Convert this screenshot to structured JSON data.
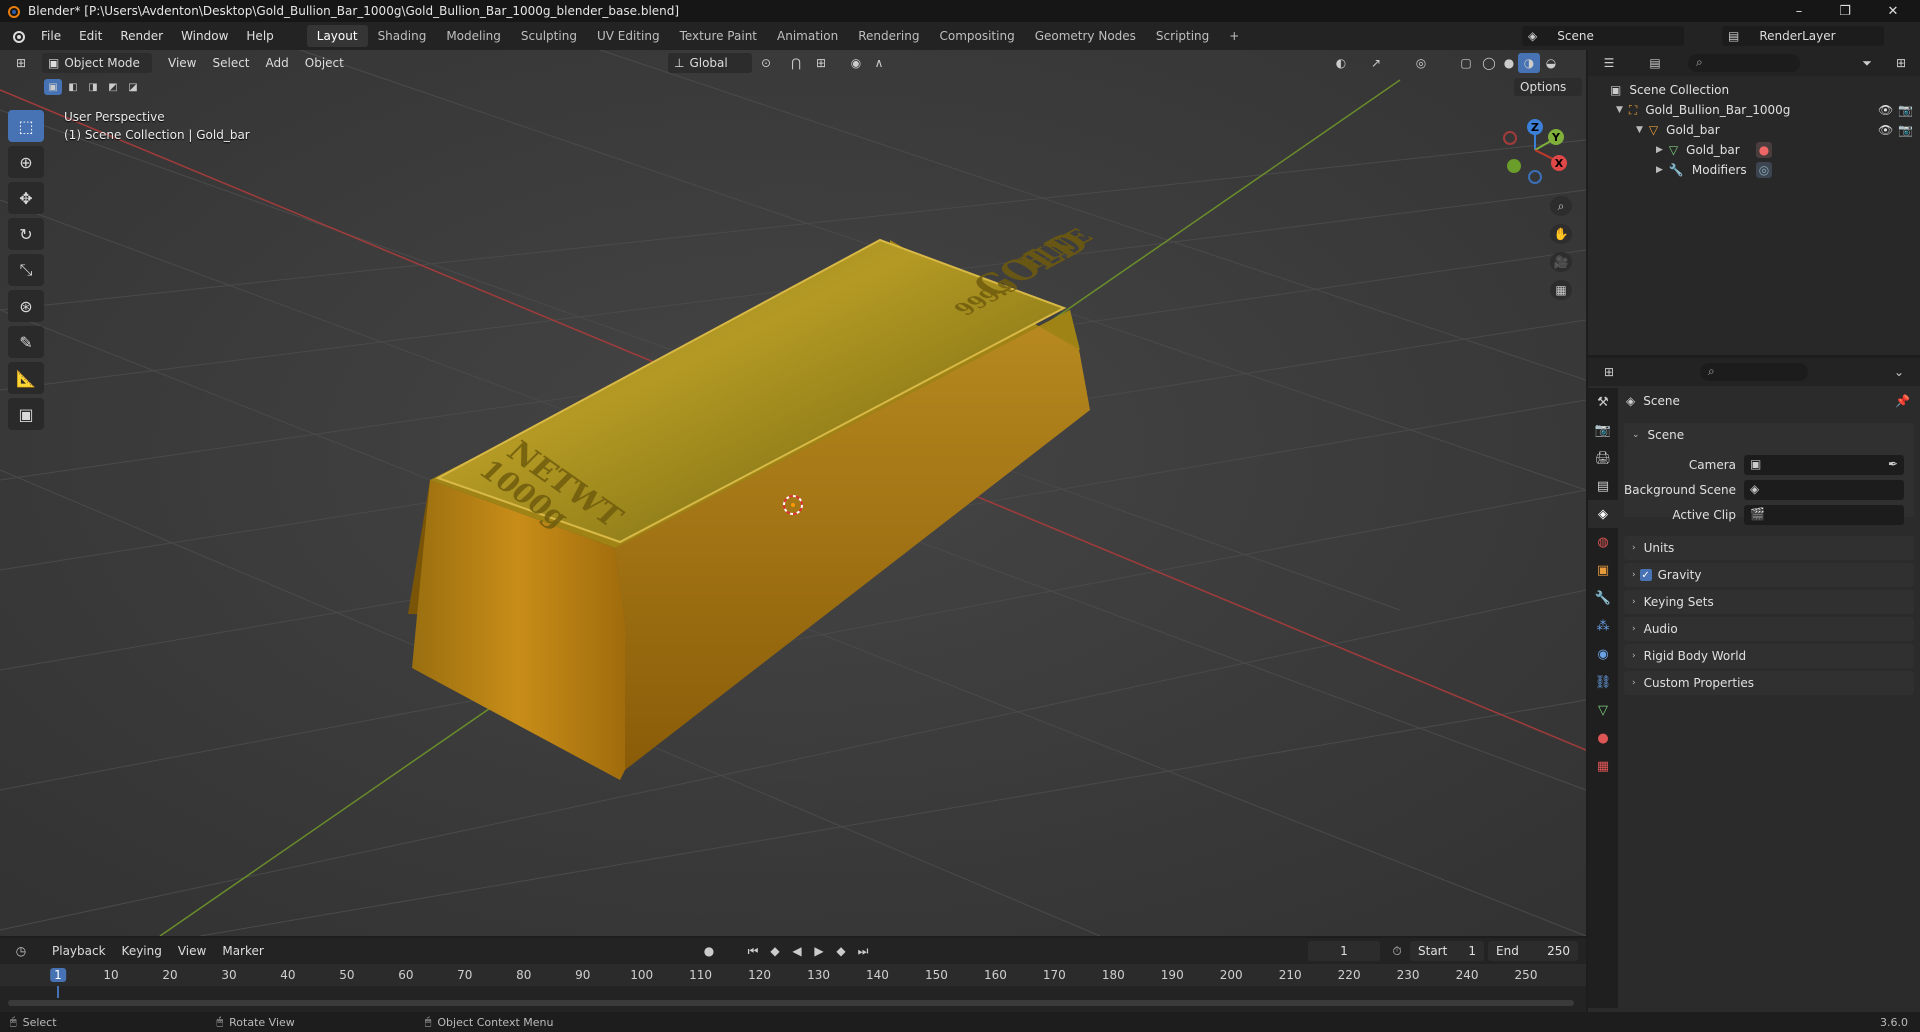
{
  "window": {
    "title": "Blender* [P:\\Users\\Avdenton\\Desktop\\Gold_Bullion_Bar_1000g\\Gold_Bullion_Bar_1000g_blender_base.blend]",
    "minimize": "–",
    "maximize": "❐",
    "close": "✕"
  },
  "menu": [
    "File",
    "Edit",
    "Render",
    "Window",
    "Help"
  ],
  "workspaces": [
    "Layout",
    "Shading",
    "Modeling",
    "Sculpting",
    "UV Editing",
    "Texture Paint",
    "Animation",
    "Rendering",
    "Compositing",
    "Geometry Nodes",
    "Scripting"
  ],
  "workspace_add": "+",
  "active_workspace": "Layout",
  "scene_name": "Scene",
  "view_layer": "RenderLayer",
  "viewport": {
    "mode": "Object Mode",
    "menus": [
      "View",
      "Select",
      "Add",
      "Object"
    ],
    "orientation": "Global",
    "options": "Options",
    "perspective": "User Perspective",
    "collection_info": "(1) Scene Collection | Gold_bar",
    "gizmo": {
      "z": "Z",
      "y": "Y",
      "x": "X"
    },
    "bar_text": {
      "line1": "FINE",
      "line2": "GOLD",
      "line3": "999.9",
      "line4": "NETWT",
      "line5": "1000g"
    }
  },
  "outliner": {
    "root": "Scene Collection",
    "rows": [
      {
        "label": "Gold_Bullion_Bar_1000g",
        "indent": 1
      },
      {
        "label": "Gold_bar",
        "indent": 2
      },
      {
        "label": "Gold_bar",
        "indent": 3
      },
      {
        "label": "Modifiers",
        "indent": 3
      }
    ]
  },
  "properties": {
    "header": "Scene",
    "section": "Scene",
    "fields": [
      {
        "label": "Camera"
      },
      {
        "label": "Background Scene"
      },
      {
        "label": "Active Clip"
      }
    ],
    "panels": [
      "Units",
      "Gravity",
      "Keying Sets",
      "Audio",
      "Rigid Body World",
      "Custom Properties"
    ],
    "gravity_checked": true
  },
  "timeline": {
    "menus": [
      "Playback",
      "Keying",
      "View",
      "Marker"
    ],
    "current_frame": "1",
    "start_label": "Start",
    "start": "1",
    "end_label": "End",
    "end": "250",
    "ticks": [
      "1",
      "10",
      "20",
      "30",
      "40",
      "50",
      "60",
      "70",
      "80",
      "90",
      "100",
      "110",
      "120",
      "130",
      "140",
      "150",
      "160",
      "170",
      "180",
      "190",
      "200",
      "210",
      "220",
      "230",
      "240",
      "250"
    ]
  },
  "status": {
    "select": "Select",
    "rotate": "Rotate View",
    "context": "Object Context Menu",
    "version": "3.6.0"
  },
  "colors": {
    "accent": "#4772b3",
    "x_axis": "#c0392b",
    "y_axis": "#7fb03b",
    "z_axis": "#3b7fd6",
    "gold": "#c9a227"
  }
}
